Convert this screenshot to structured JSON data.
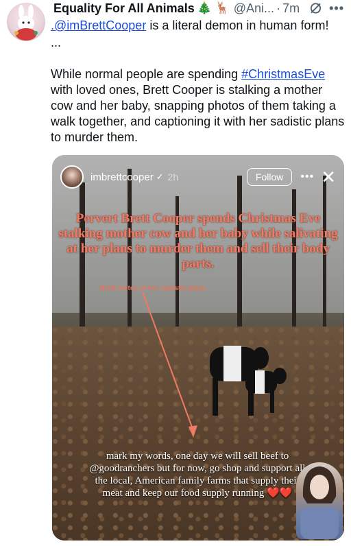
{
  "tweet": {
    "author_name": "Equality For All Animals",
    "author_emojis": "🎄 🦌",
    "handle": "@Ani...",
    "dot": "·",
    "time": "7m",
    "more": "•••",
    "mention": ".@imBrettCooper",
    "text_line1_rest": " is a literal demon in human form!",
    "ellipsis": "...",
    "para2_before": "While normal people are spending ",
    "hashtag": "#ChristmasEve",
    "para2_after": " with loved ones, Brett Cooper is stalking a mother cow and her baby, snapping photos of them taking a walk together, and captioning it with her sadistic plans to murder them."
  },
  "story": {
    "username": "imbrettcooper",
    "verified": "✓",
    "time": "2h",
    "follow_label": "Follow",
    "more": "•••",
    "close": "✕",
    "overlay_red": "Pervert Brett Cooper spends Christmas Eve stalking mother cow and her baby while salivating at her plans to murder them and sell their body parts.",
    "overlay_small": "Brett writes of her sadistic plans",
    "caption": "mark my words, one day we will sell beef to @goodranchers but for now, go shop and support all the local, American family farms that supply their meat and keep our food supply running ❤️❤️"
  },
  "colors": {
    "link": "#1d4ed8",
    "overlay_red": "#f07a62",
    "muted": "#536471"
  }
}
